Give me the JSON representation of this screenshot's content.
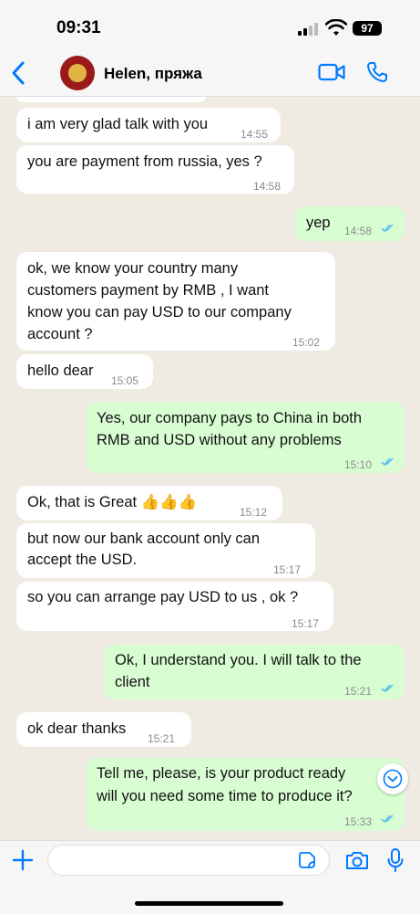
{
  "status_bar": {
    "time": "09:31",
    "battery": "97"
  },
  "header": {
    "contact_name": "Helen, пряжа"
  },
  "messages": [
    {
      "dir": "in",
      "lines": [
        "i am very glad talk with you"
      ],
      "time": "14:55"
    },
    {
      "dir": "in",
      "lines": [
        "you are payment from russia, yes ?"
      ],
      "time": "14:58"
    },
    {
      "dir": "out",
      "lines": [
        "yep"
      ],
      "time": "14:58",
      "read": true
    },
    {
      "dir": "in",
      "lines": [
        "ok, we know your country many",
        "customers payment by RMB , I want",
        "know you can pay USD to our company",
        "account ?"
      ],
      "time": "15:02"
    },
    {
      "dir": "in",
      "lines": [
        "hello dear"
      ],
      "time": "15:05"
    },
    {
      "dir": "out",
      "lines": [
        "Yes, our company pays to China in both",
        "RMB and USD without any problems"
      ],
      "time": "15:10",
      "read": true
    },
    {
      "dir": "in",
      "lines": [
        "Ok, that is Great 👍👍👍"
      ],
      "time": "15:12"
    },
    {
      "dir": "in",
      "lines": [
        "but now our bank account only can",
        "accept the USD."
      ],
      "time": "15:17"
    },
    {
      "dir": "in",
      "lines": [
        "so you can arrange pay USD to us , ok ?"
      ],
      "time": "15:17"
    },
    {
      "dir": "out",
      "lines": [
        "Ok, I understand you. I will talk to the",
        "client"
      ],
      "time": "15:21",
      "read": true
    },
    {
      "dir": "in",
      "lines": [
        "ok dear thanks"
      ],
      "time": "15:21"
    },
    {
      "dir": "out",
      "lines": [
        "Tell me, please, is your product ready",
        "will you need some time to produce it?"
      ],
      "time": "15:33",
      "read": true
    }
  ],
  "composer": {
    "placeholder": ""
  },
  "colors": {
    "incoming": "#ffffff",
    "outgoing": "#d9fdd3",
    "accent": "#007aff",
    "read_ticks": "#53bdeb",
    "background": "#efeae2"
  }
}
